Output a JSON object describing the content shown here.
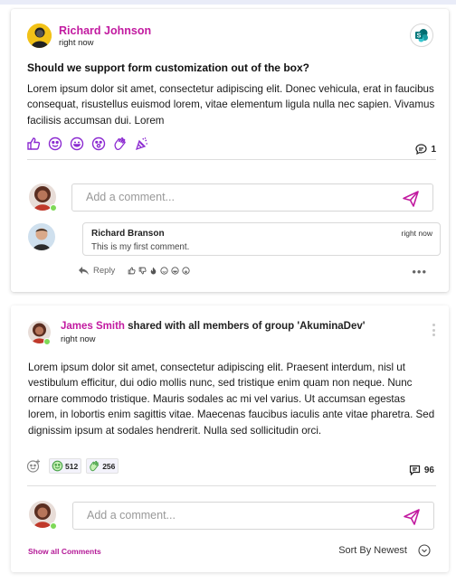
{
  "colors": {
    "accent": "#c21aa0",
    "online": "#7ed957"
  },
  "post1": {
    "author": "Richard Johnson",
    "time": "right now",
    "app_icon": "sharepoint-icon",
    "title": "Should we support form customization out of the box?",
    "body": "Lorem ipsum dolor sit amet, consectetur adipiscing elit. Donec vehicula, erat in faucibus consequat, risustellus euismod lorem, vitae elementum ligula nulla nec sapien. Vivamus facilisis accumsan dui. Lorem",
    "reactions": [
      "thumbs-up-icon",
      "smile-icon",
      "laugh-icon",
      "wow-icon",
      "clap-icon",
      "celebrate-icon"
    ],
    "comment_count": "1",
    "comment_placeholder": "Add a comment...",
    "comment": {
      "author": "Richard Branson",
      "time": "right now",
      "text": "This is my first comment.",
      "reply_label": "Reply"
    },
    "more_label": "•••"
  },
  "post2": {
    "author": "James Smith",
    "shared_text": "shared with all members of group 'AkuminaDev'",
    "time": "right now",
    "body": "Lorem ipsum dolor sit amet, consectetur adipiscing elit. Praesent interdum, nisl ut vestibulum efficitur, dui odio mollis nunc, sed tristique enim quam non neque. Nunc ornare commodo tristique. Mauris sodales ac mi vel varius. Ut accumsan egestas lorem, in lobortis enim sagittis vitae. Maecenas faucibus iaculis ante vitae pharetra. Sed dignissim ipsum at sodales hendrerit. Nulla sed sollicitudin orci.",
    "reaction_counts": [
      {
        "icon": "smile-icon",
        "count": "512"
      },
      {
        "icon": "clap-icon",
        "count": "256"
      }
    ],
    "comment_count": "96",
    "comment_placeholder": "Add a comment...",
    "show_all_label": "Show all Comments",
    "sort_label": "Sort By Newest"
  }
}
